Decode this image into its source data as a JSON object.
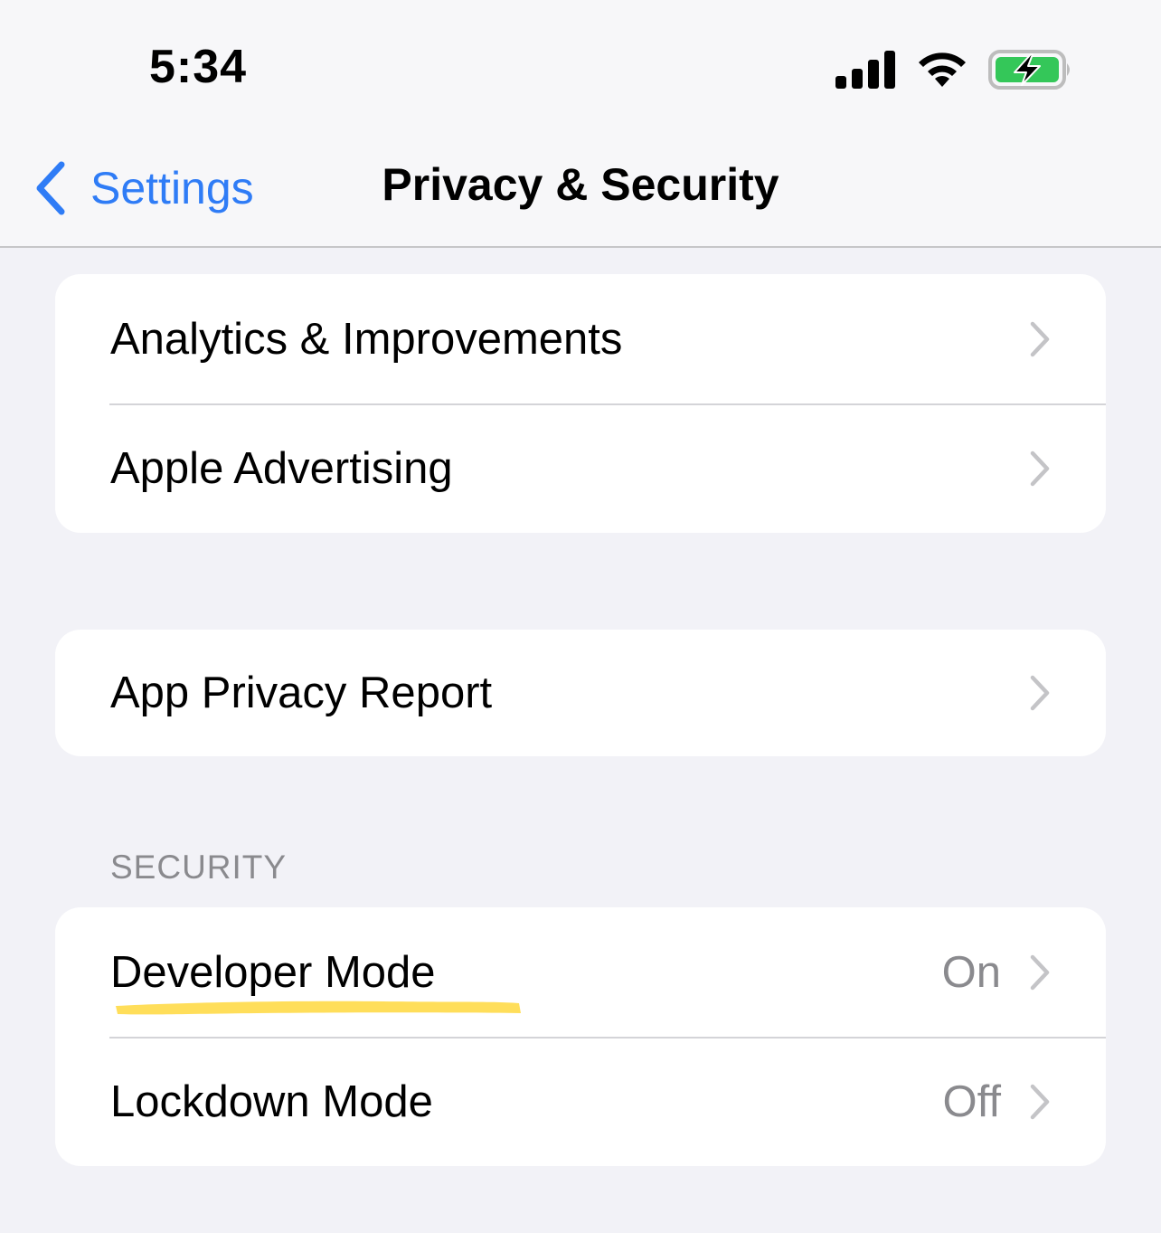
{
  "status_bar": {
    "time": "5:34",
    "icons": [
      "signal-icon",
      "wifi-icon",
      "battery-charging-icon"
    ],
    "battery_color": "#34c759"
  },
  "nav": {
    "back_label": "Settings",
    "title": "Privacy & Security",
    "accent_color": "#2f7cf6"
  },
  "groups": {
    "general": {
      "items": [
        {
          "label": "Analytics & Improvements"
        },
        {
          "label": "Apple Advertising"
        }
      ]
    },
    "report": {
      "items": [
        {
          "label": "App Privacy Report"
        }
      ]
    },
    "security": {
      "header": "SECURITY",
      "items": [
        {
          "label": "Developer Mode",
          "value": "On"
        },
        {
          "label": "Lockdown Mode",
          "value": "Off"
        }
      ]
    }
  },
  "annotation": {
    "highlight_color": "#ffd83d"
  }
}
